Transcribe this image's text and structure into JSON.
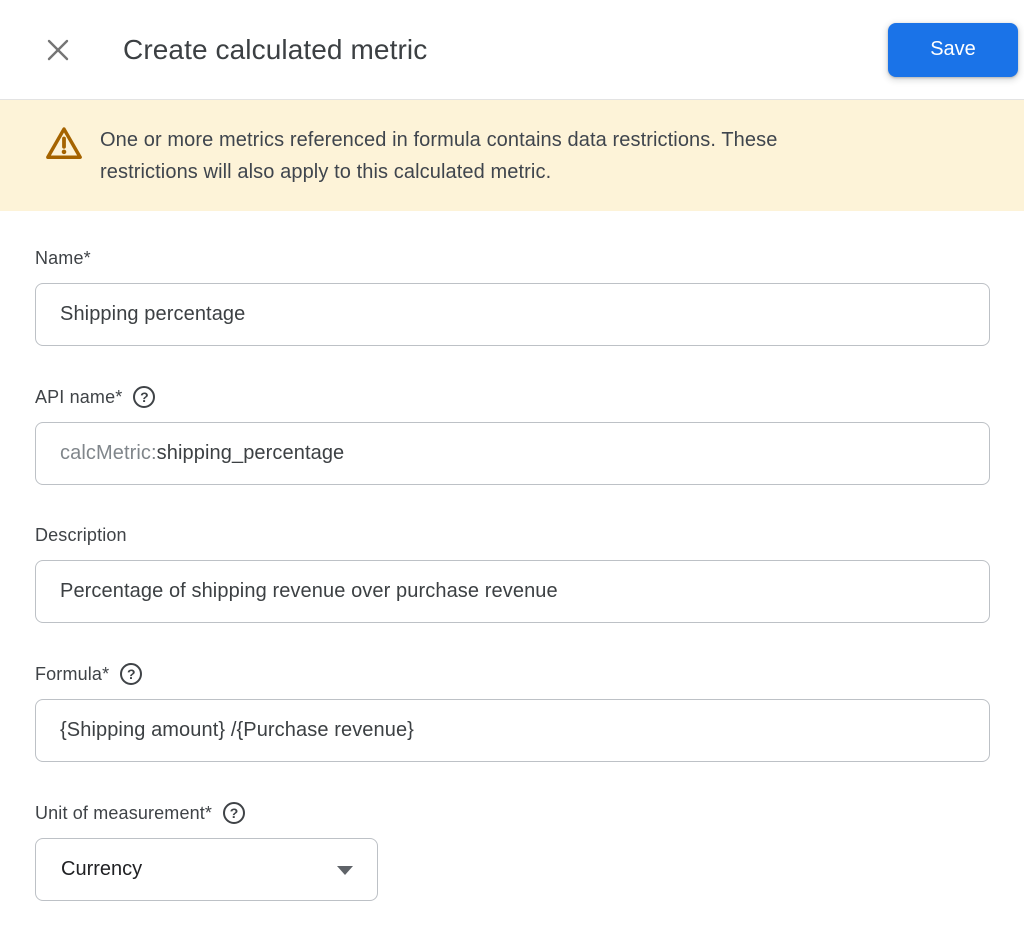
{
  "header": {
    "title": "Create calculated metric",
    "save_label": "Save"
  },
  "banner": {
    "text": "One or more metrics referenced in formula contains data restrictions. These\nrestrictions will also apply to this calculated metric."
  },
  "icons": {
    "help": "?"
  },
  "fields": {
    "name": {
      "label": "Name*",
      "value": "Shipping percentage"
    },
    "api_name": {
      "label": "API name*",
      "prefix": "calcMetric:",
      "value": "shipping_percentage"
    },
    "description": {
      "label": "Description",
      "value": "Percentage of shipping revenue over purchase revenue"
    },
    "formula": {
      "label": "Formula*",
      "value": "{Shipping amount} /{Purchase revenue}"
    },
    "unit": {
      "label": "Unit of measurement*",
      "value": "Currency"
    }
  },
  "colors": {
    "accent": "#1a73e8",
    "banner_bg": "#fdf3d8",
    "warning_icon": "#a56300",
    "input_border": "#bdc1c6",
    "text_primary": "#3c4043",
    "text_secondary": "#80868b"
  }
}
